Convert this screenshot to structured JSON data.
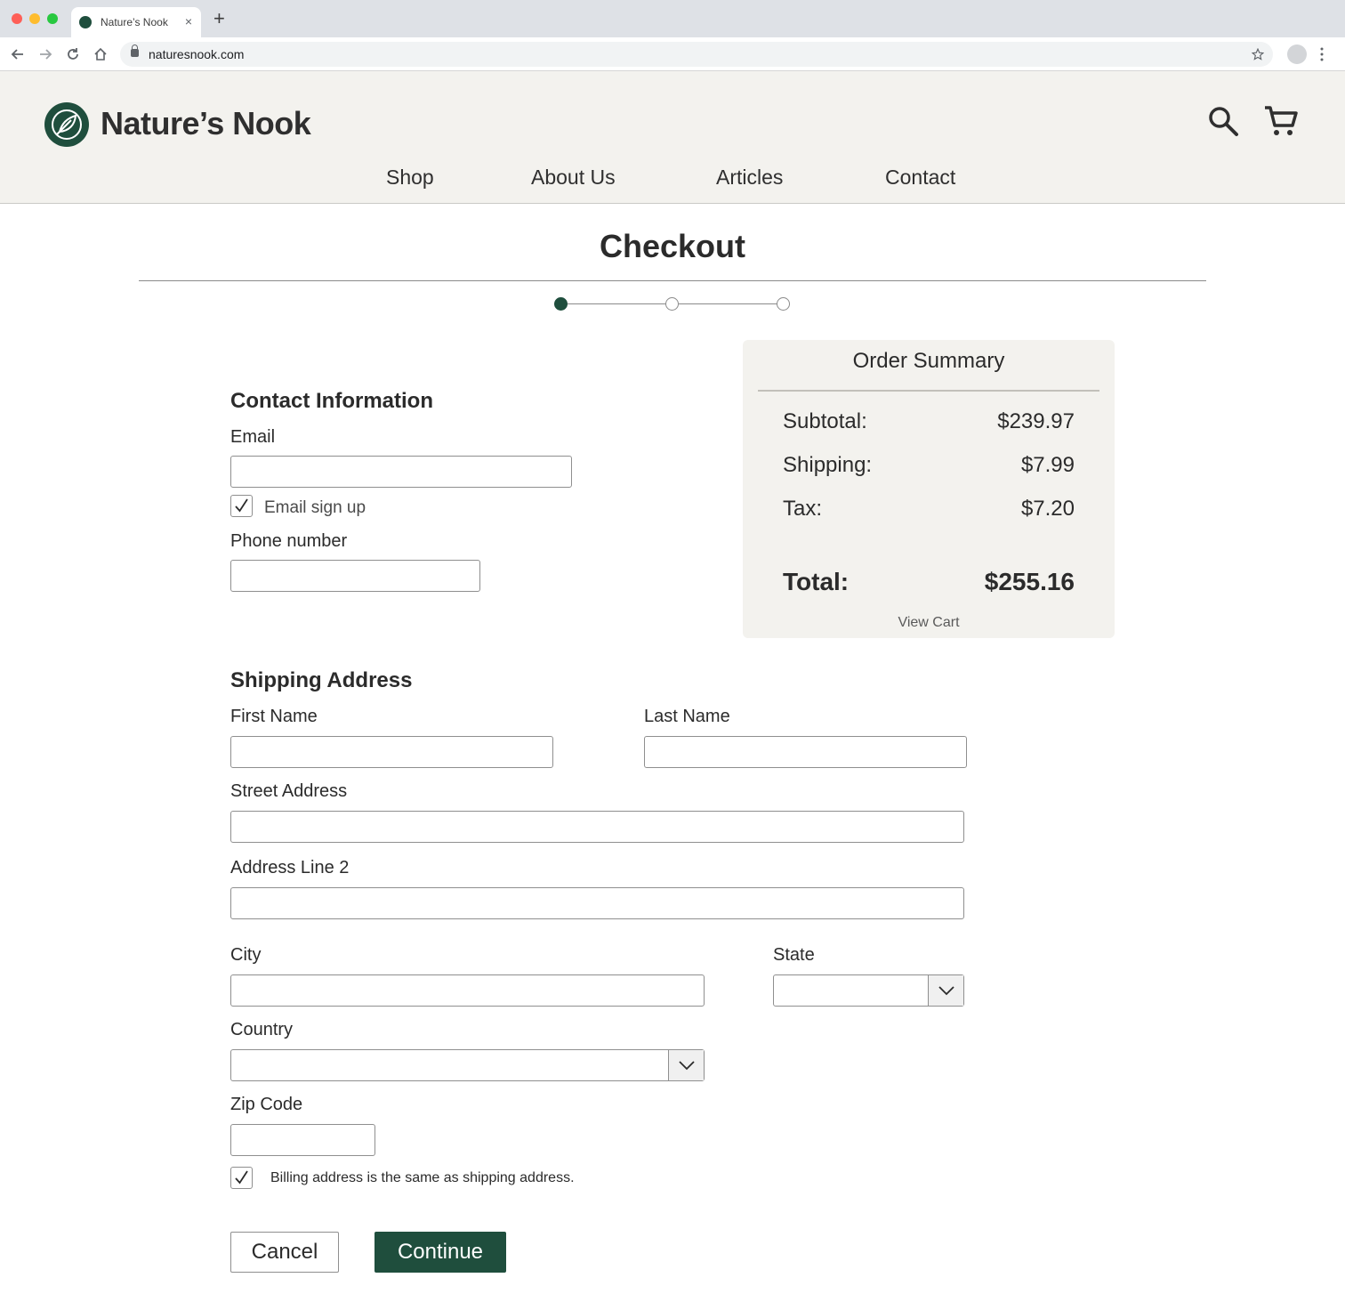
{
  "browser": {
    "tab_title": "Nature’s Nook",
    "tab_close": "×",
    "new_tab": "+",
    "url": "naturesnook.com"
  },
  "site": {
    "name": "Nature’s Nook",
    "nav": [
      "Shop",
      "About Us",
      "Articles",
      "Contact"
    ]
  },
  "checkout": {
    "title": "Checkout",
    "steps": {
      "total": 3,
      "current": 1
    },
    "contact": {
      "heading": "Contact Information",
      "email_label": "Email",
      "email_value": "",
      "email_signup_label": "Email sign up",
      "email_signup_checked": true,
      "phone_label": "Phone number",
      "phone_value": ""
    },
    "shipping": {
      "heading": "Shipping Address",
      "first_name_label": "First Name",
      "last_name_label": "Last Name",
      "street_label": "Street Address",
      "address2_label": "Address Line 2",
      "city_label": "City",
      "state_label": "State",
      "state_value": "",
      "country_label": "Country",
      "country_value": "",
      "zip_label": "Zip Code",
      "billing_same_label": "Billing address is the same as shipping address.",
      "billing_same_checked": true
    },
    "summary": {
      "title": "Order Summary",
      "subtotal_label": "Subtotal:",
      "subtotal_value": "$239.97",
      "shipping_label": "Shipping:",
      "shipping_value": "$7.99",
      "tax_label": "Tax:",
      "tax_value": "$7.20",
      "total_label": "Total:",
      "total_value": "$255.16",
      "view_cart": "View Cart"
    },
    "buttons": {
      "cancel": "Cancel",
      "continue": "Continue"
    }
  },
  "colors": {
    "brand": "#1f4e3d",
    "header_bg": "#f3f2ee"
  }
}
